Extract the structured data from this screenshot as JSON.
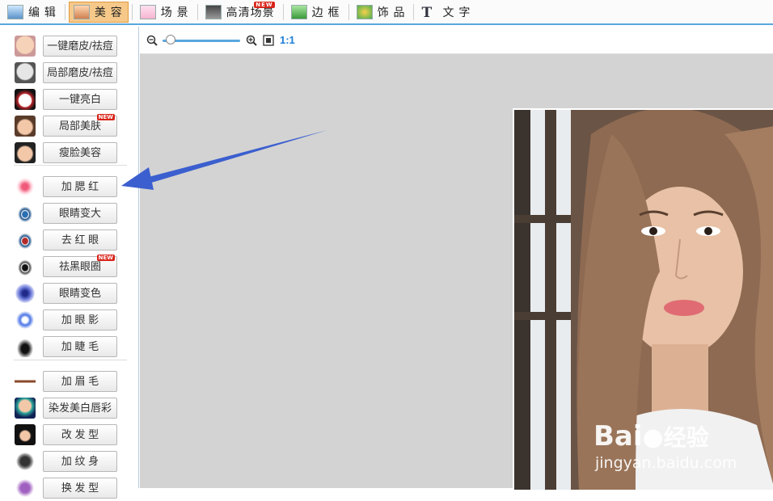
{
  "tabs": [
    {
      "label": "编 辑",
      "active": false,
      "new": false
    },
    {
      "label": "美 容",
      "active": true,
      "new": false
    },
    {
      "label": "场 景",
      "active": false,
      "new": false
    },
    {
      "label": "高清场景",
      "active": false,
      "new": true
    },
    {
      "label": "边 框",
      "active": false,
      "new": false
    },
    {
      "label": "饰 品",
      "active": false,
      "new": false
    },
    {
      "label": "文 字",
      "active": false,
      "new": false
    }
  ],
  "new_badge": "NEW",
  "sidebar": {
    "items": [
      {
        "label": "一键磨皮/祛痘",
        "icon": "face-smooth-icon"
      },
      {
        "label": "局部磨皮/祛痘",
        "icon": "face-partial-icon"
      },
      {
        "label": "一键亮白",
        "icon": "opera-mask-icon"
      },
      {
        "label": "局部美肤",
        "icon": "face-skin-icon",
        "new": true
      },
      {
        "label": "瘦脸美容",
        "icon": "slim-face-icon"
      },
      {
        "label": "加 腮 红",
        "icon": "blush-icon"
      },
      {
        "label": "眼睛变大",
        "icon": "eye-enlarge-icon"
      },
      {
        "label": "去 红 眼",
        "icon": "red-eye-icon"
      },
      {
        "label": "祛黑眼圈",
        "icon": "dark-circle-icon",
        "new": true
      },
      {
        "label": "眼睛变色",
        "icon": "eye-color-icon"
      },
      {
        "label": "加 眼 影",
        "icon": "eye-shadow-icon"
      },
      {
        "label": "加 睫 毛",
        "icon": "eyelash-icon"
      },
      {
        "label": "加 眉 毛",
        "icon": "eyebrow-icon"
      },
      {
        "label": "染发美白唇彩",
        "icon": "hair-dye-icon"
      },
      {
        "label": "改 发 型",
        "icon": "hairstyle-icon"
      },
      {
        "label": "加 纹 身",
        "icon": "tattoo-icon"
      },
      {
        "label": "换 发 型",
        "icon": "more-icon"
      }
    ]
  },
  "toolbar": {
    "zoom_ratio_label": "1:1",
    "zoom_level": 0.05
  },
  "watermark": {
    "brand": "Bai",
    "brand_cn": "经验",
    "url": "jingyan.baidu.com"
  },
  "colors": {
    "accent": "#5aa7de",
    "active_tab": "#f6c98a",
    "arrow": "#3b5fcf",
    "canvas_bg": "#d3d3d3"
  }
}
